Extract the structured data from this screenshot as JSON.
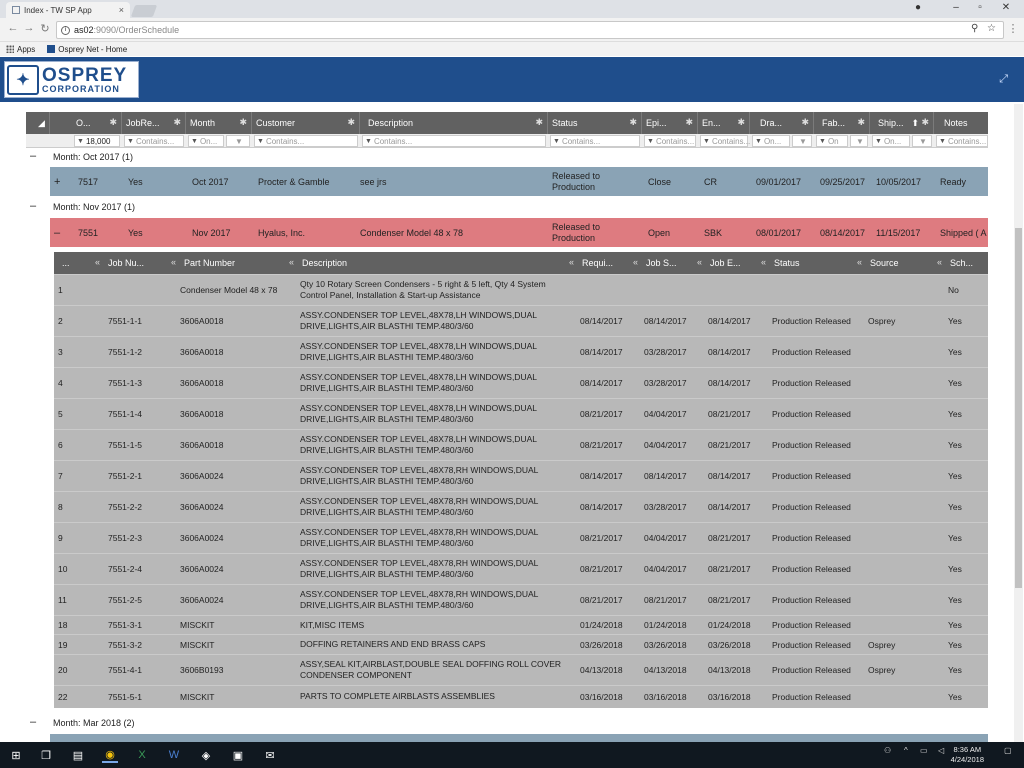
{
  "browser": {
    "tab_title": "Index - TW SP App",
    "url_host": "as02",
    "url_path": ":9090/OrderSchedule",
    "bookmarks": [
      "Apps",
      "Osprey Net - Home"
    ]
  },
  "app": {
    "logo_word": "OSPREY",
    "logo_sub": "CORPORATION"
  },
  "grid": {
    "columns": [
      "O...",
      "JobRe...",
      "Month",
      "Customer",
      "Description",
      "Status",
      "Epi...",
      "En...",
      "Dra...",
      "Fab...",
      "Ship...",
      "Notes"
    ],
    "filters": {
      "order": "18,000",
      "contains": "Contains...",
      "on": "On...",
      "on_short": "On"
    },
    "groups": [
      {
        "label": "Month: Oct 2017 (1)"
      },
      {
        "label": "Month: Nov 2017 (1)"
      },
      {
        "label": "Month: Mar 2018 (2)"
      }
    ],
    "orders": [
      {
        "order": "7517",
        "jobrel": "Yes",
        "month": "Oct 2017",
        "customer": "Procter & Gamble",
        "description": "see jrs",
        "status": "Released to Production",
        "epi": "Close",
        "eng": "CR",
        "draw": "09/01/2017",
        "fab": "09/25/2017",
        "ship": "10/05/2017",
        "notes": "Ready"
      },
      {
        "order": "7551",
        "jobrel": "Yes",
        "month": "Nov 2017",
        "customer": "Hyalus, Inc.",
        "description": "Condenser Model 48 x 78",
        "status": "Released to Production",
        "epi": "Open",
        "eng": "SBK",
        "draw": "08/01/2017",
        "fab": "08/14/2017",
        "ship": "11/15/2017",
        "notes": "Shipped ( A"
      }
    ]
  },
  "subgrid": {
    "columns": [
      "...",
      "Job Nu...",
      "Part Number",
      "Description",
      "Requi...",
      "Job S...",
      "Job E...",
      "Status",
      "Source",
      "Sch..."
    ],
    "rows": [
      {
        "line": "1",
        "job": "",
        "part": "Condenser Model 48 x 78",
        "desc": "Qty 10 Rotary Screen Condensers - 5 right & 5 left, Qty 4 System Control Panel, Installation & Start-up Assistance",
        "req": "",
        "js": "",
        "je": "",
        "status": "",
        "source": "",
        "sch": "No"
      },
      {
        "line": "2",
        "job": "7551-1-1",
        "part": "3606A0018",
        "desc": "ASSY.CONDENSER TOP LEVEL,48X78,LH WINDOWS,DUAL DRIVE,LIGHTS,AIR BLASTHI TEMP.480/3/60",
        "req": "08/14/2017",
        "js": "08/14/2017",
        "je": "08/14/2017",
        "status": "Production Released",
        "source": "Osprey",
        "sch": "Yes"
      },
      {
        "line": "3",
        "job": "7551-1-2",
        "part": "3606A0018",
        "desc": "ASSY.CONDENSER TOP LEVEL,48X78,LH WINDOWS,DUAL DRIVE,LIGHTS,AIR BLASTHI TEMP.480/3/60",
        "req": "08/14/2017",
        "js": "03/28/2017",
        "je": "08/14/2017",
        "status": "Production Released",
        "source": "",
        "sch": "Yes"
      },
      {
        "line": "4",
        "job": "7551-1-3",
        "part": "3606A0018",
        "desc": "ASSY.CONDENSER TOP LEVEL,48X78,LH WINDOWS,DUAL DRIVE,LIGHTS,AIR BLASTHI TEMP.480/3/60",
        "req": "08/14/2017",
        "js": "03/28/2017",
        "je": "08/14/2017",
        "status": "Production Released",
        "source": "",
        "sch": "Yes"
      },
      {
        "line": "5",
        "job": "7551-1-4",
        "part": "3606A0018",
        "desc": "ASSY.CONDENSER TOP LEVEL,48X78,LH WINDOWS,DUAL DRIVE,LIGHTS,AIR BLASTHI TEMP.480/3/60",
        "req": "08/21/2017",
        "js": "04/04/2017",
        "je": "08/21/2017",
        "status": "Production Released",
        "source": "",
        "sch": "Yes"
      },
      {
        "line": "6",
        "job": "7551-1-5",
        "part": "3606A0018",
        "desc": "ASSY.CONDENSER TOP LEVEL,48X78,LH WINDOWS,DUAL DRIVE,LIGHTS,AIR BLASTHI TEMP.480/3/60",
        "req": "08/21/2017",
        "js": "04/04/2017",
        "je": "08/21/2017",
        "status": "Production Released",
        "source": "",
        "sch": "Yes"
      },
      {
        "line": "7",
        "job": "7551-2-1",
        "part": "3606A0024",
        "desc": "ASSY.CONDENSER TOP LEVEL,48X78,RH WINDOWS,DUAL DRIVE,LIGHTS,AIR BLASTHI TEMP.480/3/60",
        "req": "08/14/2017",
        "js": "08/14/2017",
        "je": "08/14/2017",
        "status": "Production Released",
        "source": "",
        "sch": "Yes"
      },
      {
        "line": "8",
        "job": "7551-2-2",
        "part": "3606A0024",
        "desc": "ASSY.CONDENSER TOP LEVEL,48X78,RH WINDOWS,DUAL DRIVE,LIGHTS,AIR BLASTHI TEMP.480/3/60",
        "req": "08/14/2017",
        "js": "03/28/2017",
        "je": "08/14/2017",
        "status": "Production Released",
        "source": "",
        "sch": "Yes"
      },
      {
        "line": "9",
        "job": "7551-2-3",
        "part": "3606A0024",
        "desc": "ASSY.CONDENSER TOP LEVEL,48X78,RH WINDOWS,DUAL DRIVE,LIGHTS,AIR BLASTHI TEMP.480/3/60",
        "req": "08/21/2017",
        "js": "04/04/2017",
        "je": "08/21/2017",
        "status": "Production Released",
        "source": "",
        "sch": "Yes"
      },
      {
        "line": "10",
        "job": "7551-2-4",
        "part": "3606A0024",
        "desc": "ASSY.CONDENSER TOP LEVEL,48X78,RH WINDOWS,DUAL DRIVE,LIGHTS,AIR BLASTHI TEMP.480/3/60",
        "req": "08/21/2017",
        "js": "04/04/2017",
        "je": "08/21/2017",
        "status": "Production Released",
        "source": "",
        "sch": "Yes"
      },
      {
        "line": "11",
        "job": "7551-2-5",
        "part": "3606A0024",
        "desc": "ASSY.CONDENSER TOP LEVEL,48X78,RH WINDOWS,DUAL DRIVE,LIGHTS,AIR BLASTHI TEMP.480/3/60",
        "req": "08/21/2017",
        "js": "08/21/2017",
        "je": "08/21/2017",
        "status": "Production Released",
        "source": "",
        "sch": "Yes"
      },
      {
        "line": "18",
        "job": "7551-3-1",
        "part": "MISCKIT",
        "desc": "KIT,MISC ITEMS",
        "req": "01/24/2018",
        "js": "01/24/2018",
        "je": "01/24/2018",
        "status": "Production Released",
        "source": "",
        "sch": "Yes"
      },
      {
        "line": "19",
        "job": "7551-3-2",
        "part": "MISCKIT",
        "desc": "DOFFING RETAINERS AND END BRASS CAPS",
        "req": "03/26/2018",
        "js": "03/26/2018",
        "je": "03/26/2018",
        "status": "Production Released",
        "source": "Osprey",
        "sch": "Yes"
      },
      {
        "line": "20",
        "job": "7551-4-1",
        "part": "3606B0193",
        "desc": "ASSY,SEAL KIT,AIRBLAST,DOUBLE SEAL DOFFING ROLL COVER CONDENSER COMPONENT",
        "req": "04/13/2018",
        "js": "04/13/2018",
        "je": "04/13/2018",
        "status": "Production Released",
        "source": "Osprey",
        "sch": "Yes"
      },
      {
        "line": "22",
        "job": "7551-5-1",
        "part": "MISCKIT",
        "desc": "PARTS TO COMPLETE AIRBLASTS ASSEMBLIES",
        "req": "03/16/2018",
        "js": "03/16/2018",
        "je": "03/16/2018",
        "status": "Production Released",
        "source": "",
        "sch": "Yes"
      }
    ]
  },
  "taskbar": {
    "time": "8:36 AM",
    "date": "4/24/2018"
  }
}
